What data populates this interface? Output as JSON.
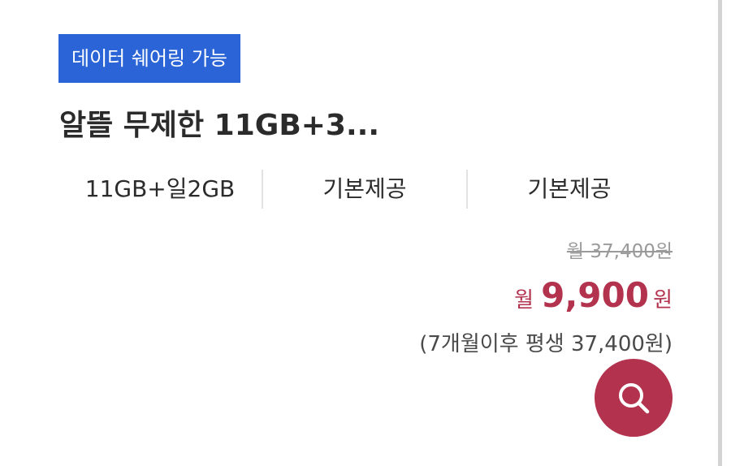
{
  "badge": {
    "label": "데이터 쉐어링 가능",
    "color": "#2a64d6"
  },
  "plan": {
    "title": "알뜰 무제한 11GB+3..."
  },
  "specs": [
    {
      "label": "11GB+일2GB"
    },
    {
      "label": "기본제공"
    },
    {
      "label": "기본제공"
    }
  ],
  "price": {
    "original": "월 37,400원",
    "sale_prefix": "월",
    "sale_amount": "9,900",
    "sale_suffix": "원",
    "after_note": "(7개월이후 평생 37,400원)",
    "accent_color": "#b3334e"
  },
  "actions": {
    "search_icon": "search-icon"
  }
}
